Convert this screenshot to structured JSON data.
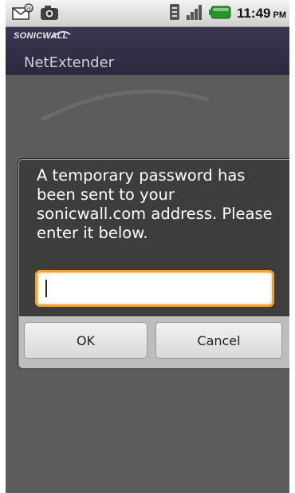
{
  "status_bar": {
    "notification_icons": [
      "email-notification-icon",
      "camera-notification-icon"
    ],
    "system_icons": [
      "sim-icon",
      "signal-icon",
      "battery-icon"
    ],
    "time": "11:49",
    "ampm": "PM"
  },
  "app": {
    "brand": "SONICWALL",
    "title": "NetExtender"
  },
  "dialog": {
    "message": "A temporary password has been sent to your sonicwall.com address. Please enter it below.",
    "input_value": "",
    "ok_label": "OK",
    "cancel_label": "Cancel"
  },
  "colors": {
    "titlebar": "#2f2b42",
    "dialog_bg": "#3d3d3d",
    "input_focus": "#f0a13a"
  }
}
